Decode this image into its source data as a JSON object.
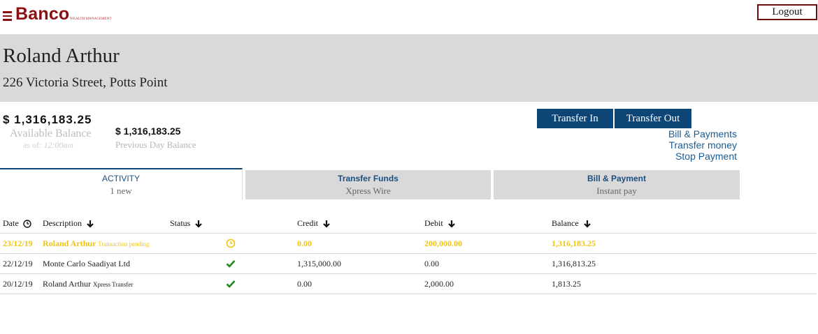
{
  "header": {
    "brand": "Banco",
    "brand_sub": "WEALTH MANAGEMENT",
    "logout_label": "Logout"
  },
  "profile": {
    "name": "Roland Arthur",
    "address": "226 Victoria Street, Potts Point"
  },
  "balances": {
    "available_amount": "$ 1,316,183.25",
    "available_label": "Available Balance",
    "as_of_label": "as of:",
    "as_of_time": "12:00am",
    "previous_amount": "$ 1,316,183.25",
    "previous_label": "Previous Day Balance"
  },
  "actions": {
    "transfer_in": "Transfer In",
    "transfer_out": "Transfer Out",
    "links": [
      "Bill & Payments",
      "Transfer money",
      "Stop Payment"
    ]
  },
  "tabs": [
    {
      "title": "ACTIVITY",
      "sub": "1 new"
    },
    {
      "title": "Transfer Funds",
      "sub": "Xpress Wire"
    },
    {
      "title": "Bill & Payment",
      "sub": "Instant pay"
    }
  ],
  "table": {
    "headers": {
      "date": "Date",
      "description": "Description",
      "status": "Status",
      "credit": "Credit",
      "debit": "Debit",
      "balance": "Balance"
    },
    "rows": [
      {
        "date": "23/12/19",
        "description": "Roland Arthur",
        "note": "Transaction pending",
        "status_icon": "clock-icon",
        "credit": "0.00",
        "debit": "200,000.00",
        "balance": "1,316,183.25"
      },
      {
        "date": "22/12/19",
        "description": "Monte Carlo Saadiyat Ltd",
        "note": "",
        "status_icon": "check-icon",
        "credit": "1,315,000.00",
        "debit": "0.00",
        "balance": "1,316,813.25"
      },
      {
        "date": "20/12/19",
        "description": "Roland Arthur",
        "note": "Xpress Transfer",
        "status_icon": "check-icon",
        "credit": "0.00",
        "debit": "2,000.00",
        "balance": "1,813.25"
      }
    ]
  },
  "colors": {
    "brand": "#8a0f0f",
    "primary_button": "#0d4577",
    "link": "#1c5c92",
    "pending": "#f1c40f",
    "success": "#1e8a1e"
  }
}
